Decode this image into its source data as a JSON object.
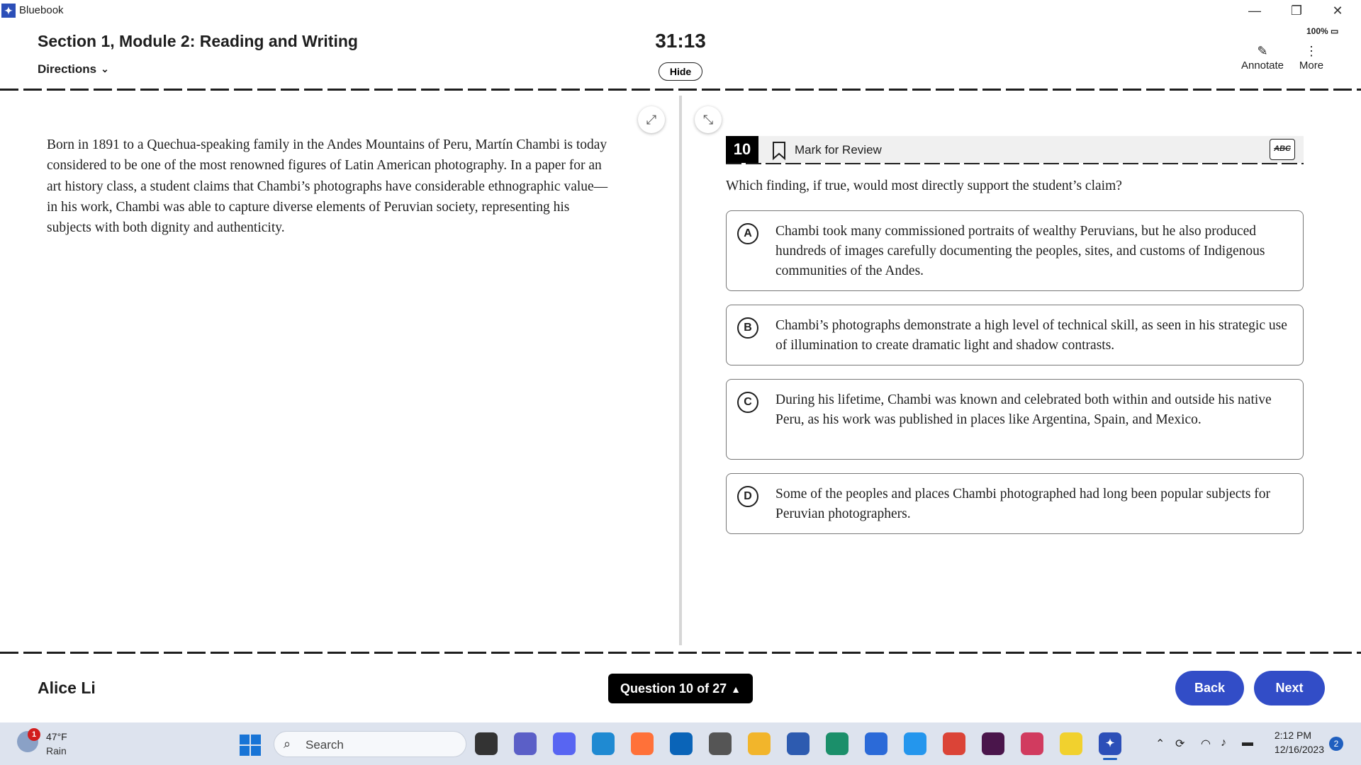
{
  "window": {
    "app_name": "Bluebook",
    "minimize": "—",
    "maximize": "❐",
    "close": "✕"
  },
  "header": {
    "section_title": "Section 1, Module 2: Reading and Writing",
    "directions_label": "Directions",
    "timer": "31:13",
    "hide_label": "Hide",
    "battery": "100%",
    "annotate_label": "Annotate",
    "more_label": "More"
  },
  "passage": {
    "text": "Born in 1891 to a Quechua-speaking family in the Andes Mountains of Peru, Martín Chambi is today considered to be one of the most renowned figures of Latin American photography. In a paper for an art history class, a student claims that Chambi’s photographs have considerable ethnographic value—in his work, Chambi was able to capture diverse elements of Peruvian society, representing his subjects with both dignity and authenticity."
  },
  "question": {
    "number": "10",
    "mark_for_review": "Mark for Review",
    "abc_label": "ABC",
    "stem": "Which finding, if true, would most directly support the student’s claim?",
    "choices": [
      {
        "letter": "A",
        "text": "Chambi took many commissioned portraits of wealthy Peruvians, but he also produced hundreds of images carefully documenting the peoples, sites, and customs of Indigenous communities of the Andes."
      },
      {
        "letter": "B",
        "text": "Chambi’s photographs demonstrate a high level of technical skill, as seen in his strategic use of illumination to create dramatic light and shadow contrasts."
      },
      {
        "letter": "C",
        "text": "During his lifetime, Chambi was known and celebrated both within and outside his native Peru, as his work was published in places like Argentina, Spain, and Mexico."
      },
      {
        "letter": "D",
        "text": "Some of the peoples and places Chambi photographed had long been popular subjects for Peruvian photographers."
      }
    ]
  },
  "footer": {
    "student_name": "Alice Li",
    "question_nav": "Question 10 of 27",
    "back_label": "Back",
    "next_label": "Next"
  },
  "taskbar": {
    "weather_temp": "47°F",
    "weather_condition": "Rain",
    "weather_badge": "1",
    "search_placeholder": "Search",
    "time": "2:12 PM",
    "date": "12/16/2023",
    "notification_count": "2",
    "apps": [
      {
        "name": "task-view",
        "color": "#333333"
      },
      {
        "name": "teams",
        "color": "#5b5fc7"
      },
      {
        "name": "discord",
        "color": "#5865f2"
      },
      {
        "name": "vscode",
        "color": "#1f8ad2"
      },
      {
        "name": "firefox",
        "color": "#ff7139"
      },
      {
        "name": "outlook",
        "color": "#0a64b8"
      },
      {
        "name": "calculator",
        "color": "#555555"
      },
      {
        "name": "file-explorer",
        "color": "#f2b52b"
      },
      {
        "name": "powershell",
        "color": "#2d5bb0"
      },
      {
        "name": "edge",
        "color": "#1b8f6a"
      },
      {
        "name": "word",
        "color": "#2b6ad8"
      },
      {
        "name": "docker",
        "color": "#2496ed"
      },
      {
        "name": "chrome",
        "color": "#db4437"
      },
      {
        "name": "slack",
        "color": "#4a154b"
      },
      {
        "name": "snipping-tool",
        "color": "#d13b5f"
      },
      {
        "name": "sticky-notes",
        "color": "#f1d12e"
      },
      {
        "name": "bluebook",
        "color": "#2c4fb8"
      }
    ]
  }
}
